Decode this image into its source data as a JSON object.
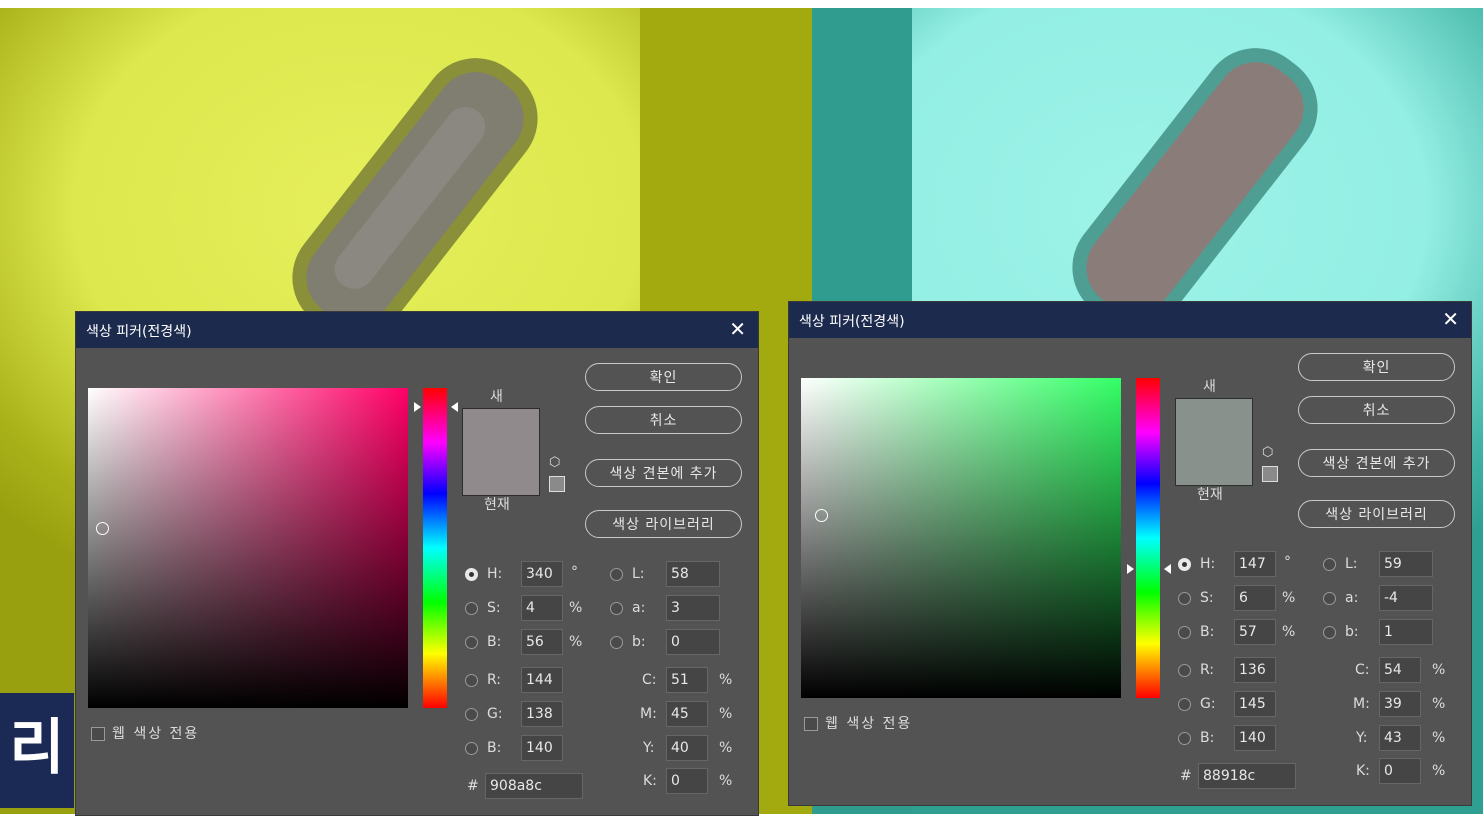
{
  "dialogs": [
    {
      "title": "색상 피커(전경색)",
      "close": "✕",
      "field_hue_color": "#ff0066",
      "new_color": "#908a8c",
      "current_color": "#908a8c",
      "labels": {
        "new": "새",
        "current": "현재"
      },
      "buttons": {
        "ok": "확인",
        "cancel": "취소",
        "add_swatch": "색상 견본에 추가",
        "library": "색상 라이브러리"
      },
      "web_only_label": "웹 색상 전용",
      "web_only_checked": false,
      "hsb": {
        "H": "340",
        "S": "4",
        "B": "56",
        "H_unit": "°",
        "S_unit": "%",
        "B_unit": "%",
        "selected": "H"
      },
      "lab": {
        "L": "58",
        "a": "3",
        "b": "0"
      },
      "rgb": {
        "R": "144",
        "G": "138",
        "B": "140"
      },
      "cmyk": {
        "C": "51",
        "M": "45",
        "Y": "40",
        "K": "0",
        "unit": "%"
      },
      "hex": "908a8c",
      "hex_prefix": "#",
      "field_labels": {
        "H": "H:",
        "S": "S:",
        "B": "B:",
        "L": "L:",
        "a": "a:",
        "b": "b:",
        "R": "R:",
        "G": "G:",
        "Bl": "B:",
        "C": "C:",
        "M": "M:",
        "Y": "Y:",
        "K": "K:"
      }
    },
    {
      "title": "색상 피커(전경색)",
      "close": "✕",
      "field_hue_color": "#33ff66",
      "new_color": "#88918c",
      "current_color": "#88918c",
      "labels": {
        "new": "새",
        "current": "현재"
      },
      "buttons": {
        "ok": "확인",
        "cancel": "취소",
        "add_swatch": "색상 견본에 추가",
        "library": "색상 라이브러리"
      },
      "web_only_label": "웹 색상 전용",
      "web_only_checked": false,
      "hsb": {
        "H": "147",
        "S": "6",
        "B": "57",
        "H_unit": "°",
        "S_unit": "%",
        "B_unit": "%",
        "selected": "H"
      },
      "lab": {
        "L": "59",
        "a": "-4",
        "b": "1"
      },
      "rgb": {
        "R": "136",
        "G": "145",
        "B": "140"
      },
      "cmyk": {
        "C": "54",
        "M": "39",
        "Y": "43",
        "K": "0",
        "unit": "%"
      },
      "hex": "88918c",
      "hex_prefix": "#",
      "field_labels": {
        "H": "H:",
        "S": "S:",
        "B": "B:",
        "L": "L:",
        "a": "a:",
        "b": "b:",
        "R": "R:",
        "G": "G:",
        "Bl": "B:",
        "C": "C:",
        "M": "M:",
        "Y": "Y:",
        "K": "K:"
      }
    }
  ],
  "background": {
    "overlay_text": "리른"
  }
}
